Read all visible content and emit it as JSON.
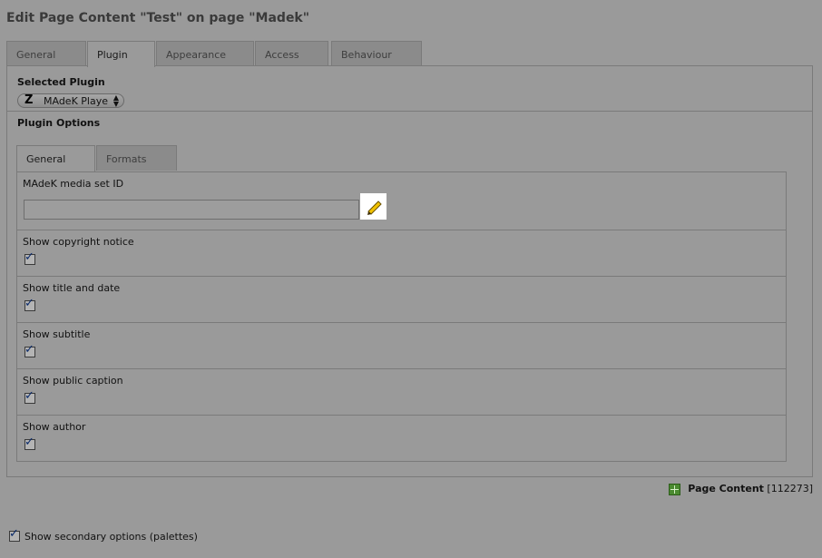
{
  "page": {
    "title": "Edit Page Content \"Test\" on page \"Madek\""
  },
  "tabs": [
    {
      "label": "General",
      "active": false
    },
    {
      "label": "Plugin",
      "active": true
    },
    {
      "label": "Appearance",
      "active": false
    },
    {
      "label": "Access",
      "active": false
    },
    {
      "label": "Behaviour",
      "active": false
    }
  ],
  "plugin": {
    "selected_label": "Selected Plugin",
    "select_logo": "Z",
    "select_value": "MAdeK Player",
    "options_label": "Plugin Options"
  },
  "subtabs": [
    {
      "label": "General",
      "active": true
    },
    {
      "label": "Formats",
      "active": false
    }
  ],
  "options": {
    "media_set": {
      "label": "MAdeK media set ID",
      "value": "",
      "icon": "pencil-icon"
    },
    "checkboxes": [
      {
        "label": "Show copyright notice",
        "checked": true
      },
      {
        "label": "Show title and date",
        "checked": true
      },
      {
        "label": "Show subtitle",
        "checked": true
      },
      {
        "label": "Show public caption",
        "checked": true
      },
      {
        "label": "Show author",
        "checked": true
      }
    ]
  },
  "footer": {
    "record_type": "Page Content",
    "record_id": "[112273]",
    "secondary_options_label": "Show secondary options (palettes)",
    "secondary_options_checked": true,
    "checkmark": "✓"
  },
  "colors": {
    "background": "#9a9a9a",
    "pencil_yellow": "#f2c200",
    "checkmark_blue": "#0a2a6a"
  }
}
